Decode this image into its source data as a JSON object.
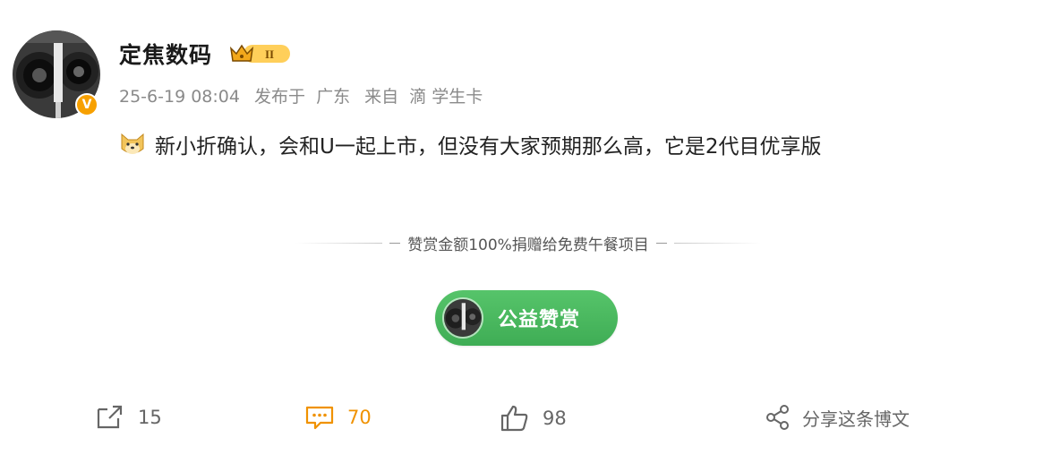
{
  "user": {
    "name": "定焦数码",
    "badge_text": "II"
  },
  "meta": {
    "time": "25-6-19 08:04",
    "publish_label": "发布于",
    "location": "广东",
    "source_label": "来自",
    "source": "滴 学生卡"
  },
  "post": {
    "text": "新小折确认，会和U一起上市，但没有大家预期那么高，它是2代目优享版"
  },
  "donation": {
    "notice": "赞赏金额100%捐赠给免费午餐项目",
    "button_label": "公益赞赏"
  },
  "actions": {
    "repost_count": "15",
    "comment_count": "70",
    "like_count": "98",
    "share_label": "分享这条博文"
  },
  "colors": {
    "accent_orange": "#f09200",
    "donate_green": "#4cbb60",
    "verified_orange": "#f7a000"
  }
}
